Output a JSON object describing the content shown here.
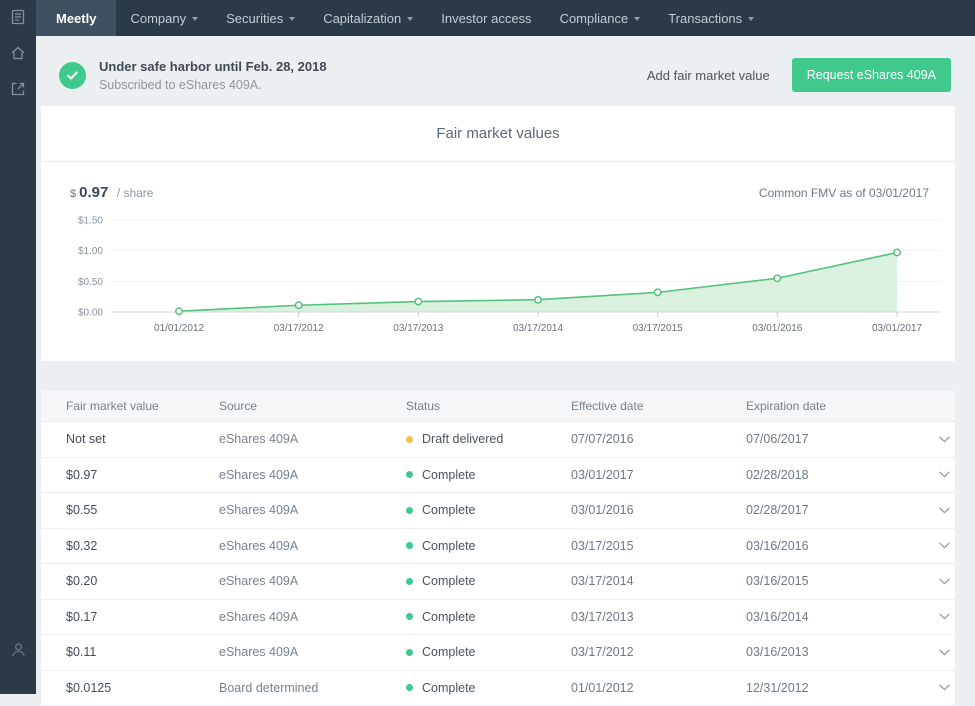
{
  "nav": {
    "brand": "Meetly",
    "items": [
      {
        "label": "Company",
        "dropdown": true
      },
      {
        "label": "Securities",
        "dropdown": true
      },
      {
        "label": "Capitalization",
        "dropdown": true
      },
      {
        "label": "Investor access",
        "dropdown": false
      },
      {
        "label": "Compliance",
        "dropdown": true
      },
      {
        "label": "Transactions",
        "dropdown": true
      }
    ]
  },
  "rail_icons": [
    "documents-icon",
    "home-icon",
    "export-icon",
    "user-icon"
  ],
  "banner": {
    "title": "Under safe harbor until Feb. 28, 2018",
    "subtitle": "Subscribed to eShares 409A.",
    "link_label": "Add fair market value",
    "button_label": "Request eShares 409A"
  },
  "card": {
    "title": "Fair market values",
    "fmv_currency": "$",
    "fmv_value": "0.97",
    "fmv_unit": "/ share",
    "fmv_note": "Common FMV as of 03/01/2017"
  },
  "chart_data": {
    "type": "area",
    "x": [
      "01/01/2012",
      "03/17/2012",
      "03/17/2013",
      "03/17/2014",
      "03/17/2015",
      "03/01/2016",
      "03/01/2017"
    ],
    "values": [
      0.0125,
      0.11,
      0.17,
      0.2,
      0.32,
      0.55,
      0.97
    ],
    "yticks": [
      {
        "value": 0,
        "label": "$0.00"
      },
      {
        "value": 0.5,
        "label": "$0.50"
      },
      {
        "value": 1.0,
        "label": "$1.00"
      },
      {
        "value": 1.5,
        "label": "$1.50"
      }
    ],
    "ylim": [
      0,
      1.5
    ],
    "grid": true,
    "line_color": "#55c17e",
    "fill_color": "#d9f1de",
    "point_fill": "#ffffff"
  },
  "table": {
    "headers": [
      "Fair market value",
      "Source",
      "Status",
      "Effective date",
      "Expiration date"
    ],
    "rows": [
      {
        "fmv": "Not set",
        "source": "eShares 409A",
        "status": "Draft delivered",
        "status_color": "#f0c24b",
        "effective": "07/07/2016",
        "expiration": "07/06/2017"
      },
      {
        "fmv": "$0.97",
        "source": "eShares 409A",
        "status": "Complete",
        "status_color": "#3fc98d",
        "effective": "03/01/2017",
        "expiration": "02/28/2018"
      },
      {
        "fmv": "$0.55",
        "source": "eShares 409A",
        "status": "Complete",
        "status_color": "#3fc98d",
        "effective": "03/01/2016",
        "expiration": "02/28/2017"
      },
      {
        "fmv": "$0.32",
        "source": "eShares 409A",
        "status": "Complete",
        "status_color": "#3fc98d",
        "effective": "03/17/2015",
        "expiration": "03/16/2016"
      },
      {
        "fmv": "$0.20",
        "source": "eShares 409A",
        "status": "Complete",
        "status_color": "#3fc98d",
        "effective": "03/17/2014",
        "expiration": "03/16/2015"
      },
      {
        "fmv": "$0.17",
        "source": "eShares 409A",
        "status": "Complete",
        "status_color": "#3fc98d",
        "effective": "03/17/2013",
        "expiration": "03/16/2014"
      },
      {
        "fmv": "$0.11",
        "source": "eShares 409A",
        "status": "Complete",
        "status_color": "#3fc98d",
        "effective": "03/17/2012",
        "expiration": "03/16/2013"
      },
      {
        "fmv": "$0.0125",
        "source": "Board determined",
        "status": "Complete",
        "status_color": "#3fc98d",
        "effective": "01/01/2012",
        "expiration": "12/31/2012"
      }
    ]
  },
  "colors": {
    "navbar": "#2c3a48",
    "accent_green": "#3fc98d",
    "warning_yellow": "#f0c24b",
    "page_bg": "#eceff1"
  }
}
